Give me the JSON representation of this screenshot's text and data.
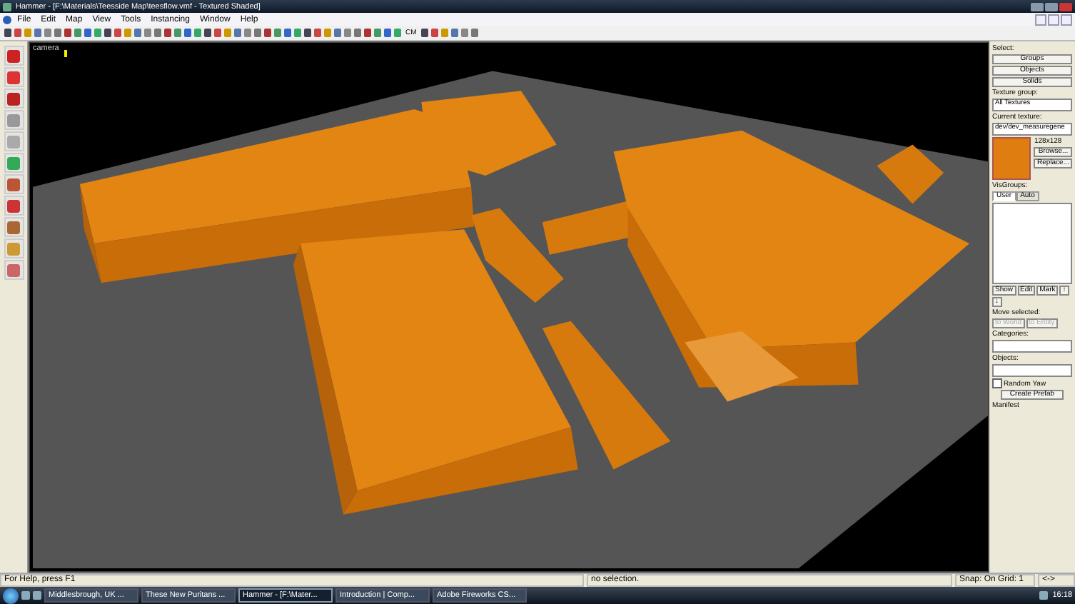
{
  "window": {
    "title": "Hammer - [F:\\Materials\\Teesside Map\\teesflow.vmf - Textured Shaded]"
  },
  "menu": [
    "File",
    "Edit",
    "Map",
    "View",
    "Tools",
    "Instancing",
    "Window",
    "Help"
  ],
  "toolbar": {
    "text_button": "CM"
  },
  "viewport": {
    "label": "camera"
  },
  "panel": {
    "select_label": "Select:",
    "select_buttons": [
      "Groups",
      "Objects",
      "Solids"
    ],
    "texture_group_label": "Texture group:",
    "texture_group": "All Textures",
    "current_texture_label": "Current texture:",
    "current_texture": "dev/dev_measuregene",
    "texture_size": "128x128",
    "texture_buttons": [
      "Browse...",
      "Replace..."
    ],
    "visgroups_label": "VisGroups:",
    "visgroup_tabs": [
      {
        "label": "User",
        "selected": true
      },
      {
        "label": "Auto",
        "selected": false
      }
    ],
    "visgroup_buttons": [
      "Show",
      "Edit",
      "Mark",
      "↑",
      "↓"
    ],
    "move_label": "Move selected:",
    "move_buttons": [
      {
        "label": "to World",
        "disabled": true
      },
      {
        "label": "to Entity",
        "disabled": true
      }
    ],
    "categories_label": "Categories:",
    "objects_label": "Objects:",
    "random_yaw": {
      "label": "Random Yaw",
      "checked": false
    },
    "prefab_button": "Create Prefab",
    "manifest_label": "Manifest"
  },
  "status_bar": {
    "help": "For Help, press F1",
    "selection": "no selection.",
    "snap": "Snap: On Grid: 1",
    "extra": "<->"
  },
  "taskbar": {
    "tasks": [
      {
        "label": "Middlesbrough, UK ...",
        "selected": false
      },
      {
        "label": "These New Puritans ...",
        "selected": false
      },
      {
        "label": "Hammer - [F:\\Mater...",
        "selected": true
      },
      {
        "label": "Introduction | Comp...",
        "selected": false
      },
      {
        "label": "Adobe Fireworks CS...",
        "selected": false
      }
    ],
    "clock": "16:18"
  }
}
